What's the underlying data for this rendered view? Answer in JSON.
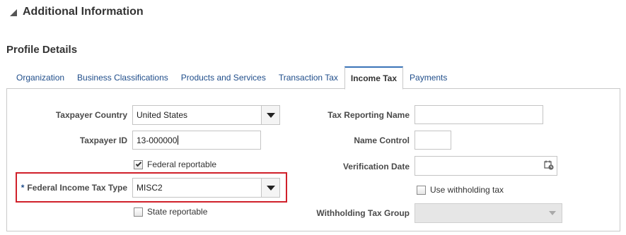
{
  "section": {
    "title": "Additional Information"
  },
  "subsection": {
    "title": "Profile Details"
  },
  "tabs": [
    {
      "label": "Organization",
      "active": false
    },
    {
      "label": "Business Classifications",
      "active": false
    },
    {
      "label": "Products and Services",
      "active": false
    },
    {
      "label": "Transaction Tax",
      "active": false
    },
    {
      "label": "Income Tax",
      "active": true
    },
    {
      "label": "Payments",
      "active": false
    }
  ],
  "form": {
    "taxpayer_country": {
      "label": "Taxpayer Country",
      "value": "United States"
    },
    "taxpayer_id": {
      "label": "Taxpayer ID",
      "value": "13-000000"
    },
    "federal_reportable": {
      "label": "Federal reportable",
      "checked": true
    },
    "federal_income_tax_type": {
      "required_mark": "*",
      "label": "Federal Income Tax Type",
      "value": "MISC2"
    },
    "state_reportable": {
      "label": "State reportable",
      "checked": false
    },
    "tax_reporting_name": {
      "label": "Tax Reporting Name",
      "value": ""
    },
    "name_control": {
      "label": "Name Control",
      "value": ""
    },
    "verification_date": {
      "label": "Verification Date",
      "value": ""
    },
    "use_withholding_tax": {
      "label": "Use withholding tax",
      "checked": false
    },
    "withholding_tax_group": {
      "label": "Withholding Tax Group",
      "value": ""
    }
  },
  "icons": {
    "collapse": "triangle-collapse-icon",
    "dropdown": "chevron-down-icon",
    "calendar": "calendar-icon"
  },
  "colors": {
    "highlight": "#d0202a",
    "tab_accent": "#3a73b8",
    "link": "#1f4d8a"
  }
}
